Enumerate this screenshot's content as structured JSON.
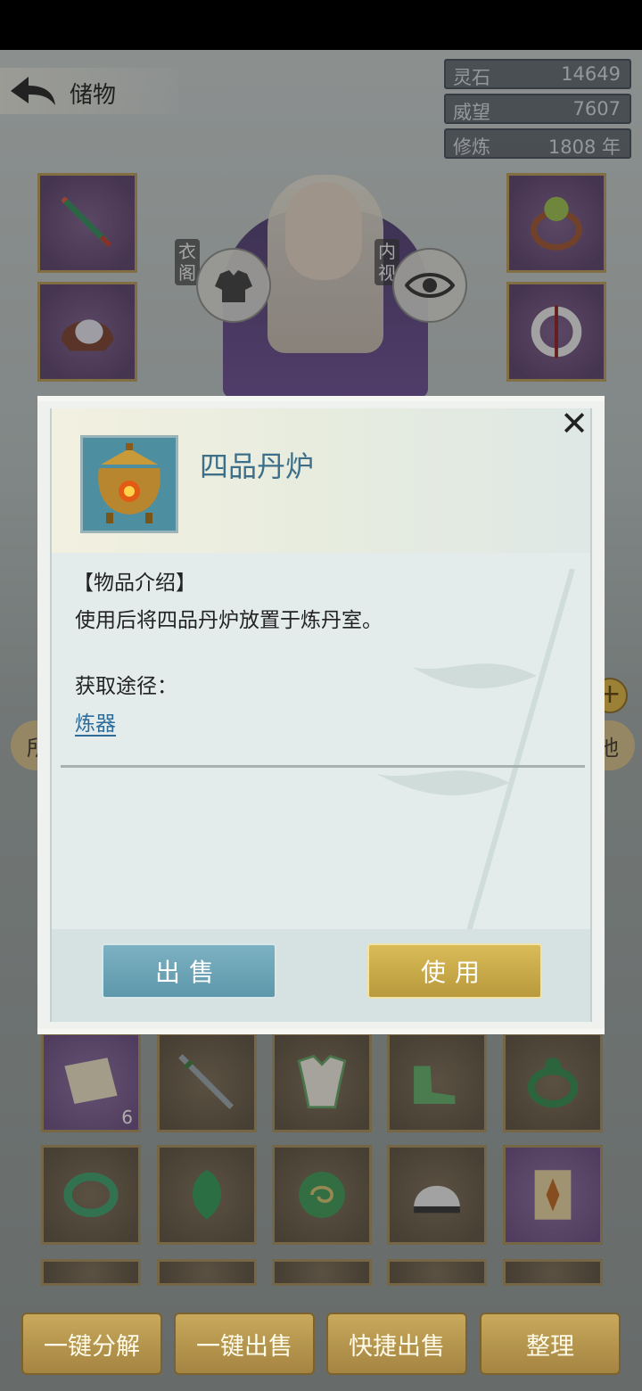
{
  "header": {
    "title": "储物"
  },
  "stats": [
    {
      "label": "灵石",
      "value": "14649"
    },
    {
      "label": "威望",
      "value": "7607"
    },
    {
      "label": "修炼",
      "value": "1808 年"
    }
  ],
  "character": {
    "wardrobe_label": "衣阁",
    "inner_view_label": "内视"
  },
  "tabs": {
    "left_partial": "所",
    "right_partial": "他"
  },
  "inventory": {
    "scroll_count": "6"
  },
  "bottom_bar": {
    "decompose": "一键分解",
    "sell_all": "一键出售",
    "quick_sell": "快捷出售",
    "organize": "整理"
  },
  "modal": {
    "item_name": "四品丹炉",
    "intro_title": "【物品介绍】",
    "intro_text": "使用后将四品丹炉放置于炼丹室。",
    "source_title": "获取途径：",
    "source_link": "炼器",
    "sell_button": "出售",
    "use_button": "使用",
    "close_symbol": "✕"
  }
}
